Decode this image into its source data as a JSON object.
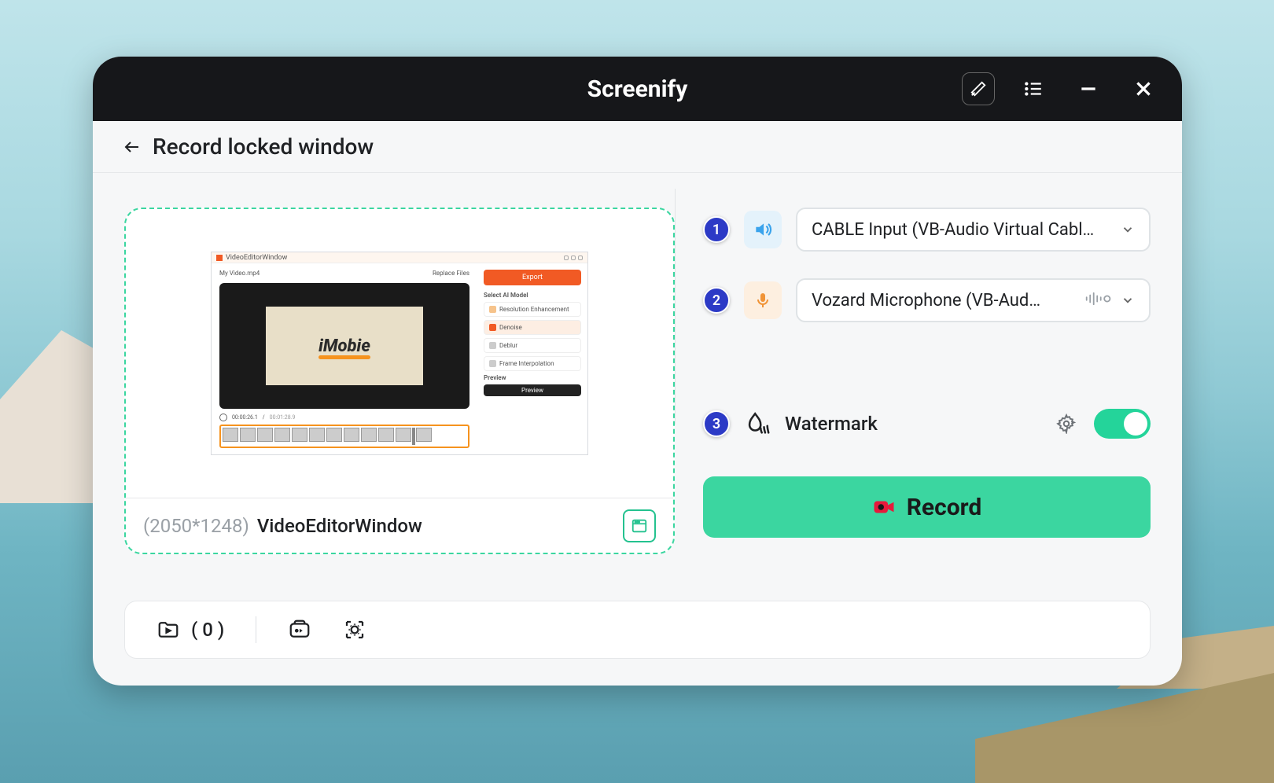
{
  "app": {
    "title": "Screenify"
  },
  "subheader": {
    "title": "Record locked window"
  },
  "preview": {
    "inner": {
      "window_title": "VideoEditorWindow",
      "filename": "My Video.mp4",
      "replace_files": "Replace Files",
      "export": "Export",
      "section_label": "Select AI Model",
      "items": [
        "Resolution Enhancement",
        "Denoise",
        "Deblur",
        "Frame Interpolation"
      ],
      "preview_label": "Preview",
      "preview_btn": "Preview",
      "logo_text": "iMobie",
      "time_current": "00:00:26.1",
      "time_total": "00:01:28.9"
    },
    "dimensions": "(2050*1248)",
    "window_name": "VideoEditorWindow"
  },
  "audio": {
    "output": {
      "badge": "1",
      "selected": "CABLE Input (VB-Audio Virtual Cabl…"
    },
    "input": {
      "badge": "2",
      "selected": "Vozard Microphone (VB-Aud…"
    }
  },
  "watermark": {
    "badge": "3",
    "label": "Watermark",
    "enabled": true
  },
  "actions": {
    "record": "Record"
  },
  "bottombar": {
    "count_label": "( 0 )"
  }
}
